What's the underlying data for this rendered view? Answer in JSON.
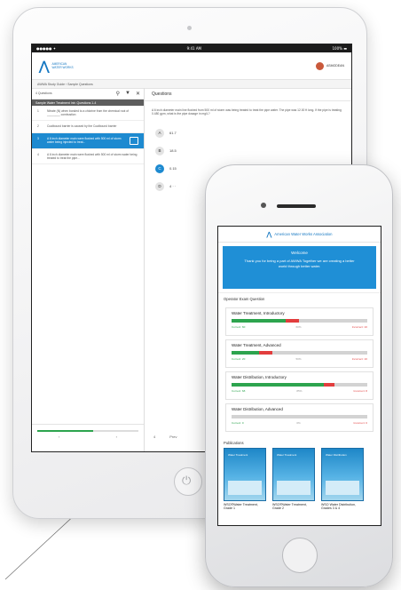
{
  "ipad": {
    "status": {
      "left": "●●●●● ✦",
      "time": "9:41 AM",
      "right": "100% ▬"
    },
    "brand": "AMERICAN WATER WORKS",
    "user_name": "ASMODEAN",
    "breadcrumb": "AWWA Study Guide  ›  Sample Questions",
    "toolbar_label": "4 Questions",
    "question_group": "Sample Water Treatment Intr. Questions 1-4",
    "questions": [
      {
        "num": "1",
        "text": "Nitrate (N) when bonded to a chlorine from the chemical root of ________ combustion",
        "active": false
      },
      {
        "num": "2",
        "text": "Coalbound barrier is caused by the Coalbound barrier",
        "active": false
      },
      {
        "num": "3",
        "text": "A 6 inch diameter main were flushed with 500 ml of storm water being injected to treat...",
        "active": true
      },
      {
        "num": "4",
        "text": "A 6 inch diameter main were flushed with 500 ml of storm water being treated to treat the pipe...",
        "active": false
      }
    ],
    "question_title": "Questions",
    "question_text": "A 6 inch diameter main line flushed from 500 ml of storm was being treated to treat the pipe water. The pipe was 12.00 ft long. If the pipe is treating 0.480 gpm, what is the pipe dosage in mg/L?",
    "answers": [
      {
        "letter": "A",
        "value": "61.7",
        "selected": false
      },
      {
        "letter": "B",
        "value": "18.5",
        "selected": false
      },
      {
        "letter": "C",
        "value": "0.15",
        "selected": true
      },
      {
        "letter": "D",
        "value": "4 · ·",
        "selected": false
      }
    ],
    "progress_pct": 55,
    "nav_prev": "‹",
    "nav_next": "›",
    "footer_left": "4",
    "footer_right": "Prev"
  },
  "phone": {
    "app_title": "American Water Works Association",
    "welcome_title": "Welcome",
    "welcome_message": "Thank you for being a part of AWWA Together we are creating a better world through better water.",
    "section_title": "Operator Exam Question",
    "cards": [
      {
        "name": "Water Treatment, Introductory",
        "correct_pct": 40,
        "wrong_pct": 10,
        "left": "Correct: 60",
        "mid": "60%",
        "right": "Incorrect: 10"
      },
      {
        "name": "Water Treatment, Advanced",
        "correct_pct": 20,
        "wrong_pct": 10,
        "left": "Correct: 20",
        "mid": "50%",
        "right": "Incorrect: 10"
      },
      {
        "name": "Water Distribution, Introductory",
        "correct_pct": 68,
        "wrong_pct": 8,
        "left": "Correct: 68",
        "mid": "85%",
        "right": "Incorrect: 8"
      },
      {
        "name": "Water Distribution, Advanced",
        "correct_pct": 0,
        "wrong_pct": 0,
        "left": "Correct: 0",
        "mid": "0%",
        "right": "Incorrect: 0"
      }
    ],
    "pubs_title": "Publications",
    "publications": [
      {
        "cover_title": "Water Treatment",
        "caption": "WSO®Water Treatment, Grade 1"
      },
      {
        "cover_title": "Water Treatment",
        "caption": "WSO®Water Treatment, Grade 2"
      },
      {
        "cover_title": "Water Distribution",
        "caption": "WSO Water Distribution, Grades 3 & 4"
      }
    ]
  },
  "colors": {
    "accent": "#1d8ad0",
    "correct": "#2da44e",
    "incorrect": "#e23d3d"
  }
}
